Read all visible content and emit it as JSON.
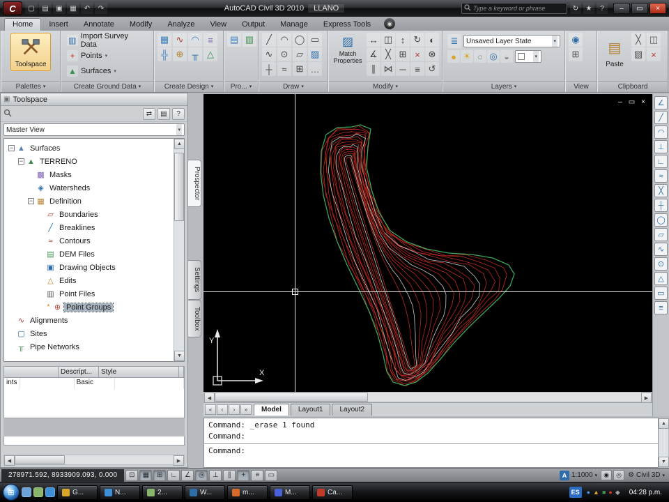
{
  "glyphs": {
    "up": "▲",
    "down": "▼",
    "left": "◀",
    "right": "▶",
    "dd": "▾"
  },
  "titlebar": {
    "app_button": "C",
    "qat": [
      {
        "name": "qnew-icon",
        "g": "▢"
      },
      {
        "name": "open-icon",
        "g": "▤"
      },
      {
        "name": "save-icon",
        "g": "▣"
      },
      {
        "name": "plot-icon",
        "g": "▦"
      },
      {
        "name": "undo-icon",
        "g": "↶"
      },
      {
        "name": "redo-icon",
        "g": "↷"
      }
    ],
    "app_title": "AutoCAD Civil 3D 2010",
    "doc_title": "LLANO",
    "search_placeholder": "Type a keyword or phrase",
    "info_icons": [
      {
        "name": "communication-center-icon",
        "g": "↻"
      },
      {
        "name": "favorites-icon",
        "g": "★"
      },
      {
        "name": "help-icon",
        "g": "?"
      }
    ],
    "window_controls": [
      {
        "name": "minimize-button",
        "g": "–"
      },
      {
        "name": "maximize-button",
        "g": "▭"
      },
      {
        "name": "close-button",
        "g": "×"
      }
    ]
  },
  "ribbon": {
    "tabs": [
      {
        "label": "Home",
        "active": true
      },
      {
        "label": "Insert"
      },
      {
        "label": "Annotate"
      },
      {
        "label": "Modify"
      },
      {
        "label": "Analyze"
      },
      {
        "label": "View"
      },
      {
        "label": "Output"
      },
      {
        "label": "Manage"
      },
      {
        "label": "Express Tools"
      }
    ],
    "options_button": "◉",
    "palettes": {
      "big_button": "Toolspace",
      "label": "Palettes",
      "dd": "▾"
    },
    "create_ground_data": {
      "label": "Create Ground Data",
      "dd": "▾",
      "items": [
        {
          "icon": "import-survey-data-icon",
          "g": "▥",
          "tint": "#2e6da8",
          "label": "Import Survey Data",
          "dd": ""
        },
        {
          "icon": "points-icon",
          "g": "+",
          "tint": "#c23b2a",
          "label": "Points",
          "dd": "▾"
        },
        {
          "icon": "surfaces-icon",
          "g": "▲",
          "tint": "#3f8f4f",
          "label": "Surfaces",
          "dd": "▾"
        }
      ]
    },
    "create_design": {
      "label": "Create Design",
      "dd": "▾",
      "icons": [
        {
          "name": "parcel-icon",
          "g": "▦",
          "tint": "#3f7fbf"
        },
        {
          "name": "alignment-icon",
          "g": "∿",
          "tint": "#b03a2e"
        },
        {
          "name": "profile-icon",
          "g": "◠",
          "tint": "#3f7fbf"
        },
        {
          "name": "corridor-icon",
          "g": "≡",
          "tint": "#7f5fb0"
        },
        {
          "name": "intersection-icon",
          "g": "╬",
          "tint": "#3f7fbf"
        },
        {
          "name": "assembly-icon",
          "g": "⊕",
          "tint": "#b07f2f"
        },
        {
          "name": "pipe-network-icon",
          "g": "╥",
          "tint": "#2e6da8"
        },
        {
          "name": "grading-icon",
          "g": "△",
          "tint": "#3f8f4f"
        }
      ]
    },
    "profile_views": {
      "label": "Pro...",
      "dd": "▾",
      "icons": [
        {
          "name": "profile-view-icon",
          "g": "▤",
          "tint": "#3f7fbf"
        },
        {
          "name": "section-views-icon",
          "g": "▥",
          "tint": "#3f8f4f"
        }
      ]
    },
    "draw": {
      "label": "Draw",
      "dd": "▾",
      "icons": [
        {
          "name": "line-icon",
          "g": "╱",
          "tint": "#444444"
        },
        {
          "name": "arc-icon",
          "g": "◠",
          "tint": "#444444"
        },
        {
          "name": "circle-icon",
          "g": "◯",
          "tint": "#444444"
        },
        {
          "name": "rectangle-icon",
          "g": "▭",
          "tint": "#444444"
        },
        {
          "name": "polyline-icon",
          "g": "∿",
          "tint": "#444444"
        },
        {
          "name": "donut-icon",
          "g": "⊙",
          "tint": "#444444"
        },
        {
          "name": "polygon-icon",
          "g": "▱",
          "tint": "#444444"
        },
        {
          "name": "hatch-icon",
          "g": "▨",
          "tint": "#2e6da8"
        },
        {
          "name": "point-icon",
          "g": "┼",
          "tint": "#444444"
        },
        {
          "name": "spline-icon",
          "g": "≈",
          "tint": "#444444"
        },
        {
          "name": "table-icon",
          "g": "⊞",
          "tint": "#444444"
        },
        {
          "name": "more-draw-icon",
          "g": "…",
          "tint": "#444444"
        }
      ]
    },
    "modify": {
      "label": "Modify",
      "dd": "▾",
      "match_properties": "Match Properties",
      "icons": [
        {
          "name": "move-icon",
          "g": "↔",
          "tint": "#444444"
        },
        {
          "name": "copy-icon",
          "g": "◫",
          "tint": "#444444"
        },
        {
          "name": "stretch-icon",
          "g": "↕",
          "tint": "#444444"
        },
        {
          "name": "rotate-icon",
          "g": "↻",
          "tint": "#444444"
        },
        {
          "name": "mirror-icon",
          "g": "◐",
          "tint": "#444444"
        },
        {
          "name": "scale-icon",
          "g": "∡",
          "tint": "#444444"
        },
        {
          "name": "trim-icon",
          "g": "╳",
          "tint": "#444444"
        },
        {
          "name": "array-icon",
          "g": "⊞",
          "tint": "#444444"
        },
        {
          "name": "erase-icon",
          "g": "×",
          "tint": "#b03a2e"
        },
        {
          "name": "explode-icon",
          "g": "⊗",
          "tint": "#444444"
        },
        {
          "name": "offset-icon",
          "g": "∥",
          "tint": "#444444"
        },
        {
          "name": "join-icon",
          "g": "⋈",
          "tint": "#444444"
        },
        {
          "name": "break-icon",
          "g": "─",
          "tint": "#444444"
        },
        {
          "name": "lengthen-icon",
          "g": "≡",
          "tint": "#444444"
        },
        {
          "name": "undo-modify-icon",
          "g": "↺",
          "tint": "#444444"
        }
      ]
    },
    "layers": {
      "label": "Layers",
      "dd": "▾",
      "layer_state": "Unsaved Layer State",
      "row2_icons": [
        {
          "name": "layer-on-icon",
          "g": "●",
          "tint": "#d8a62a"
        },
        {
          "name": "layer-freeze-icon",
          "g": "☀",
          "tint": "#d8a62a"
        },
        {
          "name": "layer-off-icon",
          "g": "○",
          "tint": "#888888"
        },
        {
          "name": "layer-lock-icon",
          "g": "◎",
          "tint": "#2e6da8"
        },
        {
          "name": "layer-isolate-icon",
          "g": "◒",
          "tint": "#888888"
        }
      ],
      "layer_swatch": "#f5f5f5"
    },
    "view_panel": {
      "label": "View",
      "dd": "",
      "icons": [
        {
          "name": "navigate-icon",
          "g": "◉",
          "tint": "#2e6da8"
        },
        {
          "name": "viewports-icon",
          "g": "⊞",
          "tint": "#555555"
        }
      ]
    },
    "clipboard": {
      "label": "Clipboard",
      "dd": "",
      "paste_label": "Paste",
      "icons": [
        {
          "name": "cut-icon",
          "g": "╳",
          "tint": "#555555"
        },
        {
          "name": "copy-clip-icon",
          "g": "◫",
          "tint": "#555555"
        },
        {
          "name": "match-properties-icon",
          "g": "▨",
          "tint": "#555555"
        },
        {
          "name": "delete-icon",
          "g": "×",
          "tint": "#b03a2e"
        }
      ]
    }
  },
  "toolspace": {
    "title": "Toolspace",
    "toolbar_icons": [
      {
        "name": "item-view-toggle-icon",
        "g": "⇄"
      },
      {
        "name": "panorama-icon",
        "g": "▤"
      },
      {
        "name": "help-icon",
        "g": "?"
      }
    ],
    "master_view": "Master View",
    "tabs": [
      {
        "label": "Prospector",
        "active": true
      },
      {
        "label": "Settings"
      },
      {
        "label": "Toolbox"
      }
    ],
    "tree": [
      {
        "label": "Surfaces",
        "level": 1,
        "expander": "−",
        "glyph": "▲",
        "tint": "#5a7fae",
        "icon": "surfaces-icon"
      },
      {
        "label": "TERRENO",
        "level": 2,
        "expander": "−",
        "glyph": "▲",
        "tint": "#3f8f4f",
        "icon": "surface-terreno-icon"
      },
      {
        "label": "Masks",
        "level": 3,
        "expander": "",
        "glyph": "▩",
        "tint": "#7f5fb0",
        "icon": "masks-icon"
      },
      {
        "label": "Watersheds",
        "level": 3,
        "expander": "",
        "glyph": "◈",
        "tint": "#2e6da8",
        "icon": "watersheds-icon"
      },
      {
        "label": "Definition",
        "level": 3,
        "expander": "−",
        "glyph": "▦",
        "tint": "#b07f2f",
        "icon": "definition-icon"
      },
      {
        "label": "Boundaries",
        "level": 4,
        "expander": "",
        "glyph": "▱",
        "tint": "#b03a2e",
        "icon": "boundaries-icon"
      },
      {
        "label": "Breaklines",
        "level": 4,
        "expander": "",
        "glyph": "╱",
        "tint": "#2e6da8",
        "icon": "breaklines-icon"
      },
      {
        "label": "Contours",
        "level": 4,
        "expander": "",
        "glyph": "≈",
        "tint": "#b03a2e",
        "icon": "contours-icon"
      },
      {
        "label": "DEM Files",
        "level": 4,
        "expander": "",
        "glyph": "▤",
        "tint": "#3f8f4f",
        "icon": "dem-files-icon"
      },
      {
        "label": "Drawing Objects",
        "level": 4,
        "expander": "",
        "glyph": "▣",
        "tint": "#2e6da8",
        "icon": "drawing-objects-icon"
      },
      {
        "label": "Edits",
        "level": 4,
        "expander": "",
        "glyph": "△",
        "tint": "#b07f2f",
        "icon": "edits-icon"
      },
      {
        "label": "Point Files",
        "level": 4,
        "expander": "",
        "glyph": "▥",
        "tint": "#555555",
        "icon": "point-files-icon"
      },
      {
        "label": "Point Groups",
        "level": 4,
        "expander": "",
        "glyph": "⊕",
        "tint": "#c23b2a",
        "icon": "point-groups-icon",
        "selected": true,
        "marker": "*"
      },
      {
        "label": "Alignments",
        "level": 1,
        "expander": "",
        "glyph": "∿",
        "tint": "#b03a2e",
        "icon": "alignments-icon"
      },
      {
        "label": "Sites",
        "level": 1,
        "expander": "",
        "glyph": "▢",
        "tint": "#2e6da8",
        "icon": "sites-icon"
      },
      {
        "label": "Pipe Networks",
        "level": 1,
        "expander": "",
        "glyph": "╥",
        "tint": "#3f8f4f",
        "icon": "pipe-networks-icon"
      }
    ],
    "list": {
      "headers": [
        {
          "label": ""
        },
        {
          "label": "Descript..."
        },
        {
          "label": "Style"
        },
        {
          "label": ""
        }
      ],
      "rows": [
        {
          "c1": "ints",
          "c2": "",
          "c3": "Basic",
          "c4": ""
        }
      ]
    }
  },
  "drawing": {
    "window_controls": [
      {
        "name": "minimize-doc-button",
        "g": "–"
      },
      {
        "name": "restore-doc-button",
        "g": "▭"
      },
      {
        "name": "close-doc-button",
        "g": "×"
      }
    ],
    "side_tool_icons": [
      {
        "name": "transparent-command-icon",
        "g": "∠"
      },
      {
        "name": "transparent-command-icon",
        "g": "╱"
      },
      {
        "name": "transparent-command-icon",
        "g": "◠"
      },
      {
        "name": "transparent-command-icon",
        "g": "⊥"
      },
      {
        "name": "transparent-command-icon",
        "g": "∟"
      },
      {
        "name": "transparent-command-icon",
        "g": "≈"
      },
      {
        "name": "transparent-command-icon",
        "g": "╳"
      },
      {
        "name": "transparent-command-icon",
        "g": "┼"
      },
      {
        "name": "transparent-command-icon",
        "g": "◯"
      },
      {
        "name": "transparent-command-icon",
        "g": "▱"
      },
      {
        "name": "transparent-command-icon",
        "g": "∿"
      },
      {
        "name": "transparent-command-icon",
        "g": "⊙"
      },
      {
        "name": "transparent-command-icon",
        "g": "△"
      },
      {
        "name": "transparent-command-icon",
        "g": "▭"
      },
      {
        "name": "transparent-command-icon",
        "g": "≡"
      }
    ],
    "ucs": {
      "x": "X",
      "y": "Y"
    },
    "tab_nav": [
      {
        "name": "first-layout-button",
        "g": "«"
      },
      {
        "name": "prev-layout-button",
        "g": "‹"
      },
      {
        "name": "next-layout-button",
        "g": "›"
      },
      {
        "name": "last-layout-button",
        "g": "»"
      }
    ],
    "layout_tabs": [
      {
        "label": "Model",
        "active": true
      },
      {
        "label": "Layout1"
      },
      {
        "label": "Layout2"
      }
    ]
  },
  "command": {
    "history": [
      "Command: _erase 1 found",
      "Command:"
    ],
    "prompt": "Command:"
  },
  "statusbar": {
    "coords": "278971.592, 8933909.093, 0.000",
    "snaps": [
      {
        "name": "infer-constraints-icon",
        "g": "⊡",
        "pressed": false
      },
      {
        "name": "snap-mode-icon",
        "g": "▦",
        "pressed": true
      },
      {
        "name": "grid-display-icon",
        "g": "⊞",
        "pressed": true
      },
      {
        "name": "ortho-mode-icon",
        "g": "∟",
        "pressed": false
      },
      {
        "name": "polar-tracking-icon",
        "g": "∠",
        "pressed": false
      },
      {
        "name": "object-snap-icon",
        "g": "◎",
        "pressed": true
      },
      {
        "name": "object-snap-tracking-icon",
        "g": "⊥",
        "pressed": false
      },
      {
        "name": "dynamic-ucs-icon",
        "g": "∥",
        "pressed": false
      },
      {
        "name": "dynamic-input-icon",
        "g": "+",
        "pressed": true
      },
      {
        "name": "lineweight-icon",
        "g": "≡",
        "pressed": false
      },
      {
        "name": "quick-properties-icon",
        "g": "▭",
        "pressed": false
      }
    ],
    "scale_prefix": "A",
    "annotation_scale": "1:1000",
    "right_icons": [
      {
        "name": "annotation-visibility-icon",
        "g": "◉"
      },
      {
        "name": "annotation-autoscale-icon",
        "g": "◎"
      }
    ],
    "workspace_gear": "⚙",
    "workspace": "Civil 3D",
    "tray_arrow": "▾"
  },
  "taskbar": {
    "quick_launch": [
      {
        "name": "show-desktop-icon",
        "color": "#6aa3d8"
      },
      {
        "name": "switch-windows-icon",
        "color": "#8ab46a"
      },
      {
        "name": "browser-icon",
        "color": "#3f8fd8"
      }
    ],
    "buttons": [
      {
        "label": "G...",
        "color": "#d8a62a"
      },
      {
        "label": "N...",
        "color": "#3f8fd8"
      },
      {
        "label": "2...",
        "color": "#8ab46a"
      },
      {
        "label": "W...",
        "color": "#2e6da8"
      },
      {
        "label": "m...",
        "color": "#d86a2a"
      },
      {
        "label": "M...",
        "color": "#4a5fd8"
      },
      {
        "label": "Ca...",
        "color": "#c23b2a"
      }
    ],
    "language": "ES",
    "tray_icons": [
      {
        "name": "tray-icon",
        "g": "●",
        "tint": "#3f8fd8"
      },
      {
        "name": "tray-icon",
        "g": "▲",
        "tint": "#d8a62a"
      },
      {
        "name": "tray-icon",
        "g": "■",
        "tint": "#3f8f4f"
      },
      {
        "name": "tray-icon",
        "g": "●",
        "tint": "#c23b2a"
      },
      {
        "name": "tray-icon",
        "g": "◆",
        "tint": "#9aa0a6"
      }
    ],
    "clock": "04:28 p.m."
  }
}
